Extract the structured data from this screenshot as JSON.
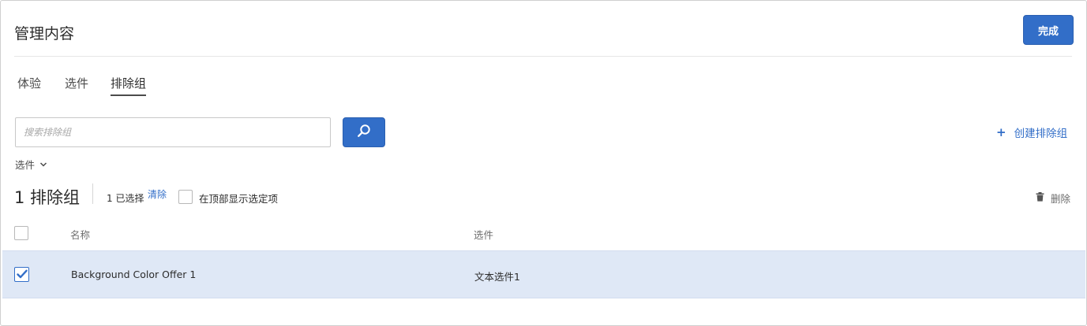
{
  "header": {
    "title": "管理内容",
    "done_label": "完成"
  },
  "tabs": [
    {
      "label": "体验",
      "active": false
    },
    {
      "label": "选件",
      "active": false
    },
    {
      "label": "排除组",
      "active": true
    }
  ],
  "search": {
    "placeholder": "搜索排除组",
    "value": ""
  },
  "actions": {
    "create_plus": "+",
    "create_label": "创建排除组",
    "delete_label": "删除"
  },
  "filter": {
    "label": "选件"
  },
  "summary": {
    "count_label": "1 排除组",
    "selected_label": "1 已选择",
    "clear_label": "清除",
    "show_selected_top_label": "在顶部显示选定项"
  },
  "table": {
    "columns": [
      "名称",
      "选件"
    ],
    "rows": [
      {
        "name": "Background Color Offer 1",
        "offer": "文本选件1",
        "selected": true
      }
    ]
  },
  "colors": {
    "accent": "#326ec8",
    "row_selected_bg": "#dfe8f6"
  }
}
